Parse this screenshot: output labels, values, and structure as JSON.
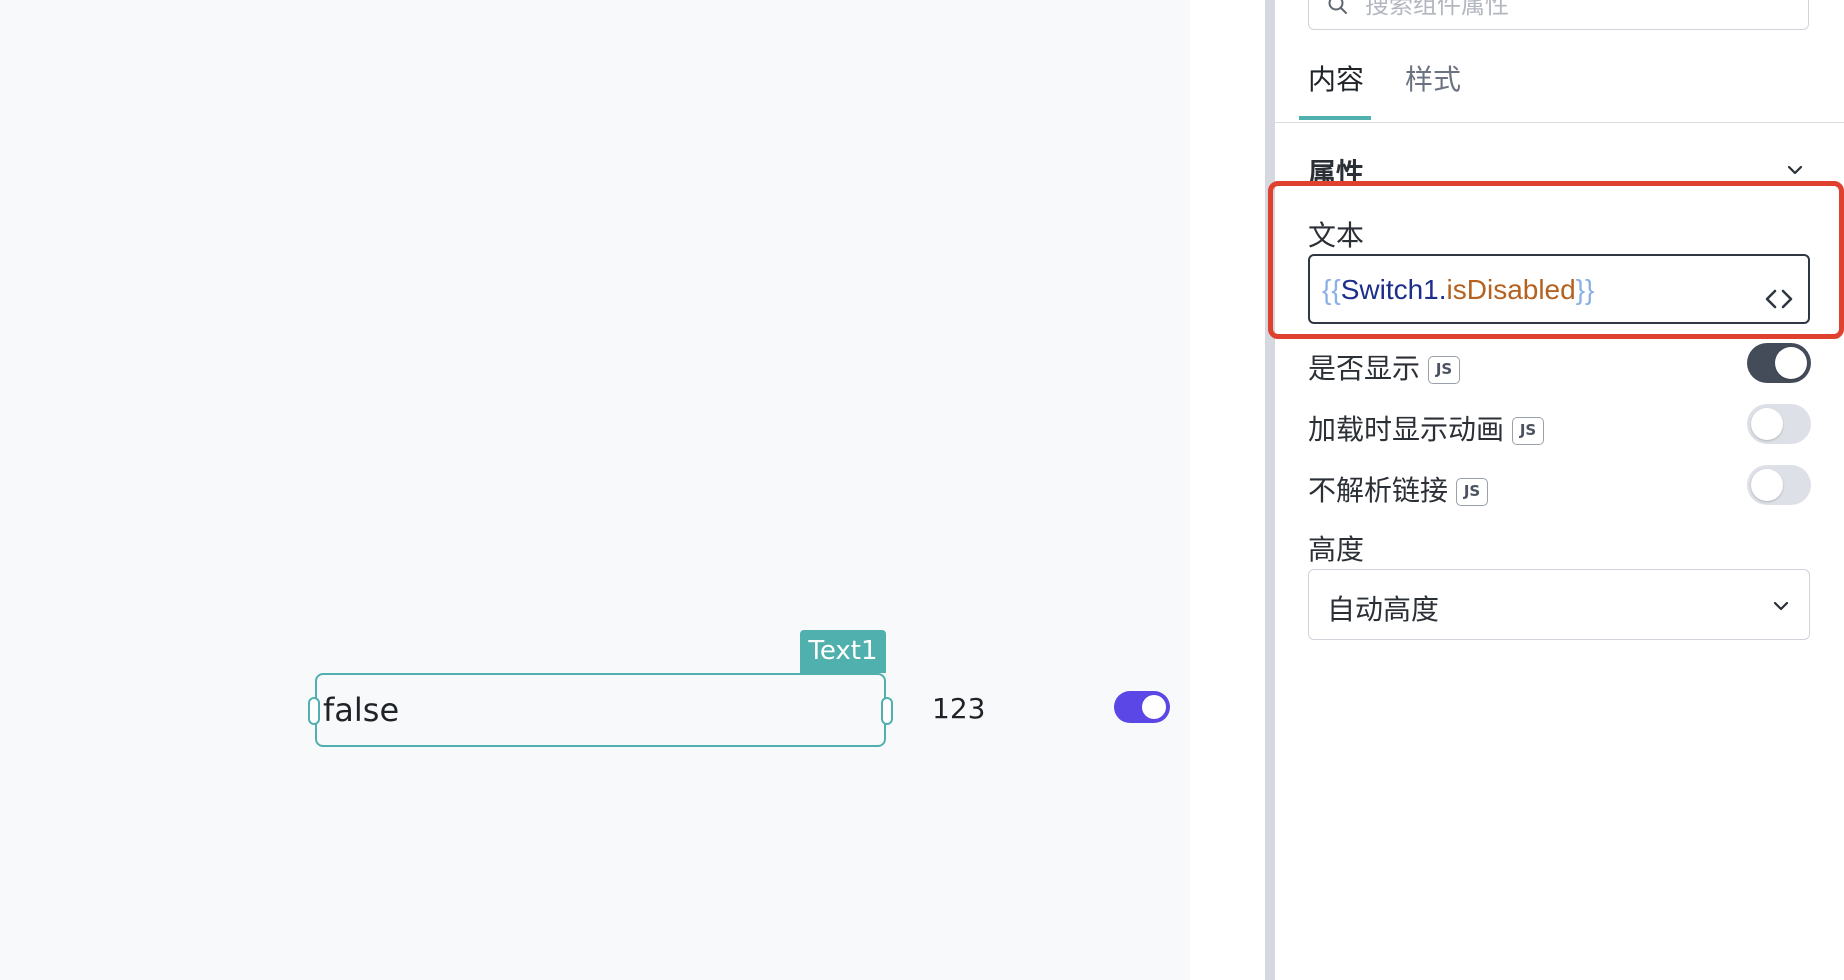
{
  "canvas": {
    "text_widget": {
      "tag": "Text1",
      "value": "false"
    },
    "number_text": "123",
    "switch_on": true,
    "switch_color": "#5a47e6"
  },
  "panel": {
    "search": {
      "placeholder": "搜索组件属性",
      "icon": "search-icon"
    },
    "tabs": [
      {
        "label": "内容",
        "active": true
      },
      {
        "label": "样式",
        "active": false
      }
    ],
    "section": {
      "title": "属性",
      "icon": "chevron-down-icon"
    },
    "text_field": {
      "label": "文本",
      "code": {
        "open": "{{",
        "object": "Switch1",
        "dot": ".",
        "property": "isDisabled",
        "close": "}}"
      },
      "toggle_icon": "code-brackets-icon"
    },
    "props": [
      {
        "label": "是否显示",
        "badge": "JS",
        "on": true
      },
      {
        "label": "加载时显示动画",
        "badge": "JS",
        "on": false
      },
      {
        "label": "不解析链接",
        "badge": "JS",
        "on": false
      }
    ],
    "height": {
      "label": "高度",
      "value": "自动高度",
      "icon": "chevron-down-icon"
    }
  },
  "colors": {
    "accent": "#4fb0ad",
    "highlight": "#e0402e",
    "toggle_on": "#454c59",
    "toggle_off": "#dde1e7"
  }
}
